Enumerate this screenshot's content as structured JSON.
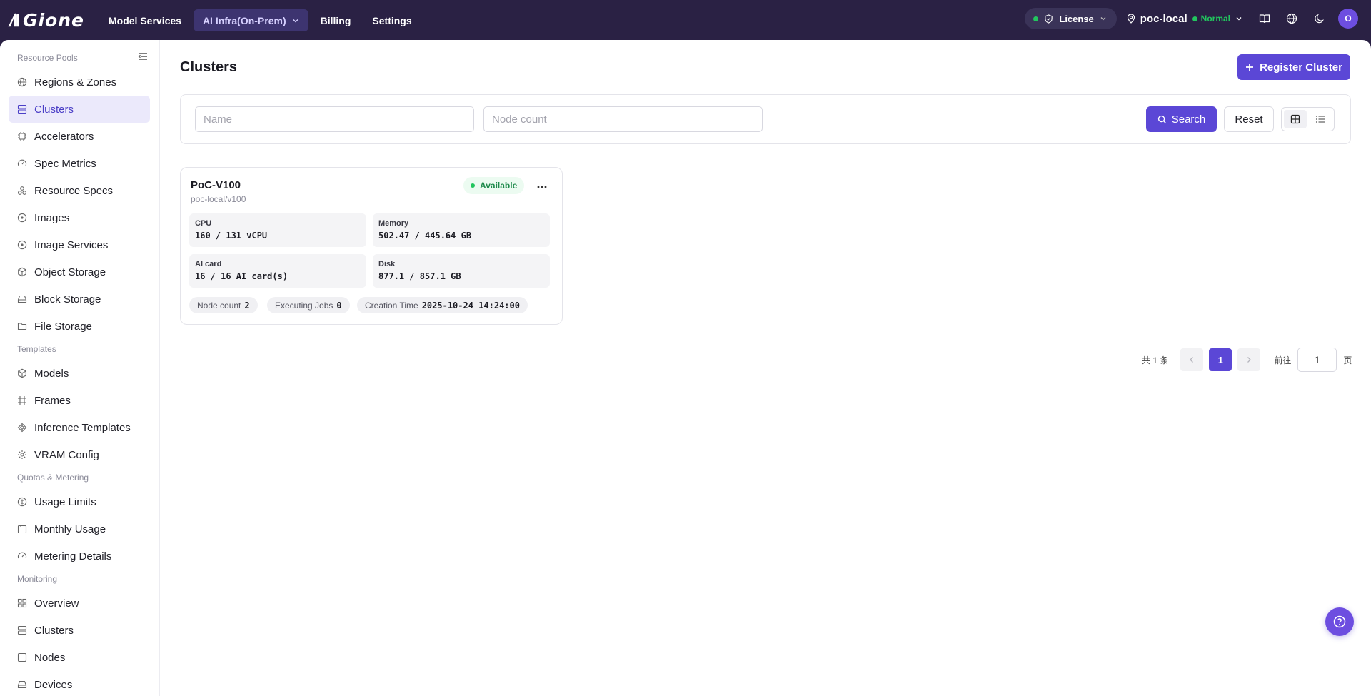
{
  "brand": {
    "logo_text": "Gione",
    "accent": "#5b47d6",
    "topbar_bg": "#2a2144"
  },
  "topnav": {
    "items": [
      {
        "label": "Model Services"
      },
      {
        "label": "AI Infra(On-Prem)"
      },
      {
        "label": "Billing"
      },
      {
        "label": "Settings"
      }
    ]
  },
  "topright": {
    "license_label": "License",
    "region_name": "poc-local",
    "region_status": "Normal",
    "avatar_initial": "O"
  },
  "sidebar": {
    "groups": [
      {
        "label": "Resource Pools"
      },
      {
        "label": "Templates"
      },
      {
        "label": "Quotas & Metering"
      },
      {
        "label": "Monitoring"
      }
    ],
    "items": [
      {
        "label": "Regions & Zones",
        "icon": "globe-icon"
      },
      {
        "label": "Clusters",
        "icon": "server-icon"
      },
      {
        "label": "Accelerators",
        "icon": "chip-icon"
      },
      {
        "label": "Spec Metrics",
        "icon": "gauge-icon"
      },
      {
        "label": "Resource Specs",
        "icon": "spec-icon"
      },
      {
        "label": "Images",
        "icon": "image-icon"
      },
      {
        "label": "Image Services",
        "icon": "image-service-icon"
      },
      {
        "label": "Object Storage",
        "icon": "cube-icon"
      },
      {
        "label": "Block Storage",
        "icon": "disk-icon"
      },
      {
        "label": "File Storage",
        "icon": "folder-icon"
      },
      {
        "label": "Models",
        "icon": "model-icon"
      },
      {
        "label": "Frames",
        "icon": "frame-icon"
      },
      {
        "label": "Inference Templates",
        "icon": "inference-icon"
      },
      {
        "label": "VRAM Config",
        "icon": "gear-icon"
      },
      {
        "label": "Usage Limits",
        "icon": "limit-icon"
      },
      {
        "label": "Monthly Usage",
        "icon": "calendar-icon"
      },
      {
        "label": "Metering Details",
        "icon": "gauge-icon"
      },
      {
        "label": "Overview",
        "icon": "grid-icon"
      },
      {
        "label": "Clusters",
        "icon": "server-icon"
      },
      {
        "label": "Nodes",
        "icon": "node-icon"
      },
      {
        "label": "Devices",
        "icon": "device-icon"
      }
    ]
  },
  "page": {
    "title": "Clusters",
    "register_button": "Register Cluster"
  },
  "filters": {
    "name_placeholder": "Name",
    "node_count_placeholder": "Node count",
    "search_label": "Search",
    "reset_label": "Reset"
  },
  "cluster": {
    "name": "PoC-V100",
    "path": "poc-local/v100",
    "status": "Available",
    "metrics": {
      "cpu_label": "CPU",
      "cpu_value": "160 / 131 vCPU",
      "memory_label": "Memory",
      "memory_value": "502.47 / 445.64 GB",
      "aicard_label": "AI card",
      "aicard_value": "16 / 16 AI card(s)",
      "disk_label": "Disk",
      "disk_value": "877.1 / 857.1 GB"
    },
    "chips": {
      "node_count_label": "Node count",
      "node_count_value": "2",
      "jobs_label": "Executing Jobs",
      "jobs_value": "0",
      "created_label": "Creation Time",
      "created_value": "2025-10-24 14:24:00"
    }
  },
  "pagination": {
    "total_text": "共 1 条",
    "current_page": "1",
    "goto_label": "前往",
    "goto_value": "1",
    "page_suffix": "页"
  }
}
